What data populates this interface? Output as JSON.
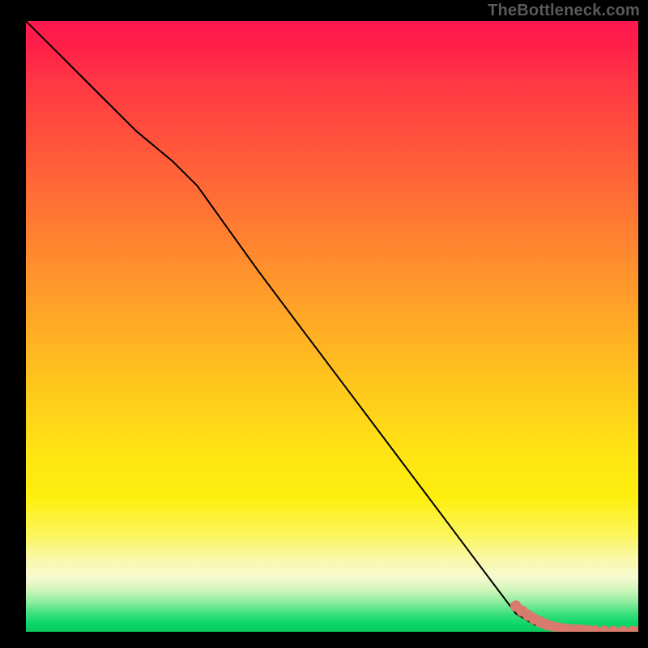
{
  "watermark": "TheBottleneck.com",
  "chart_data": {
    "type": "line",
    "title": "",
    "xlabel": "",
    "ylabel": "",
    "xlim": [
      0,
      100
    ],
    "ylim": [
      0,
      100
    ],
    "series": [
      {
        "name": "curve",
        "x": [
          0,
          6,
          12,
          18,
          24,
          28,
          33,
          38,
          44,
          50,
          56,
          62,
          68,
          74,
          80,
          83,
          85,
          87,
          89,
          91,
          93,
          95,
          97,
          99,
          100
        ],
        "y": [
          100,
          94,
          88,
          82,
          77,
          73,
          66,
          59,
          51,
          43,
          35,
          27,
          19,
          11,
          3,
          1.2,
          0.7,
          0.5,
          0.35,
          0.25,
          0.2,
          0.18,
          0.15,
          0.13,
          0.12
        ]
      }
    ],
    "markers": {
      "name": "tail-points",
      "x": [
        80,
        81,
        82,
        83,
        84,
        85,
        86,
        87,
        88,
        89,
        90,
        91,
        92,
        93,
        94.5,
        96,
        97.5,
        99,
        100
      ],
      "y": [
        4.2,
        3.4,
        2.7,
        2.1,
        1.6,
        1.2,
        0.9,
        0.7,
        0.55,
        0.45,
        0.4,
        0.35,
        0.3,
        0.28,
        0.25,
        0.2,
        0.2,
        0.18,
        0.18
      ]
    },
    "gradient_stops": [
      {
        "pct": 0,
        "color": "#ff1850"
      },
      {
        "pct": 22,
        "color": "#ff5a3a"
      },
      {
        "pct": 46,
        "color": "#ffa028"
      },
      {
        "pct": 70,
        "color": "#ffe314"
      },
      {
        "pct": 88,
        "color": "#faf8a8"
      },
      {
        "pct": 95,
        "color": "#93eea0"
      },
      {
        "pct": 100,
        "color": "#09c85d"
      }
    ],
    "colors": {
      "line": "#000000",
      "marker": "#d87a6c",
      "background_frame": "#000000",
      "watermark": "#5a5a5a"
    }
  }
}
